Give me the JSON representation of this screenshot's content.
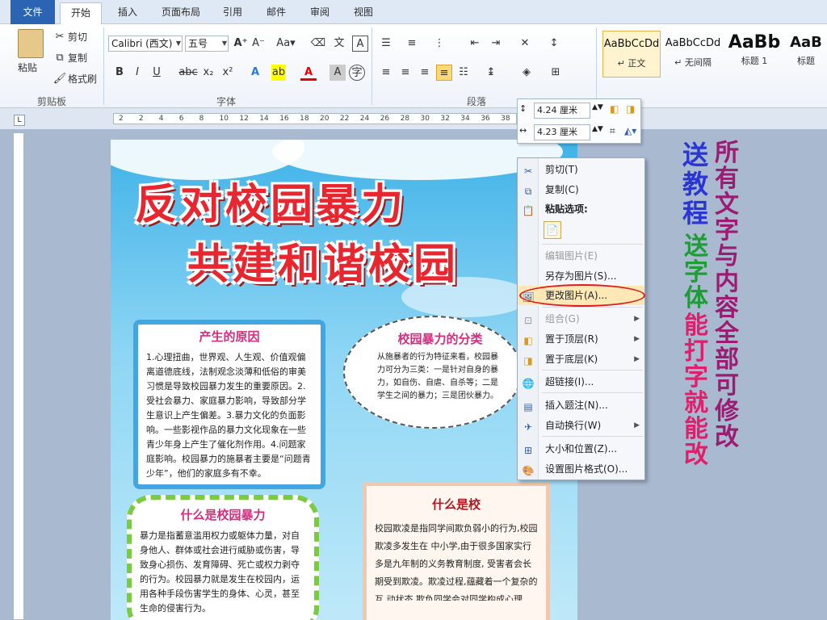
{
  "tabs": [
    "文件",
    "开始",
    "插入",
    "页面布局",
    "引用",
    "邮件",
    "审阅",
    "视图"
  ],
  "clipboard": {
    "paste": "粘贴",
    "cut": "剪切",
    "copy": "复制",
    "format_painter": "格式刷",
    "group_label": "剪贴板"
  },
  "font": {
    "name": "Calibri (西文)",
    "size": "五号",
    "group_label": "字体"
  },
  "paragraph": {
    "group_label": "段落"
  },
  "styles": [
    {
      "sample": "AaBbCcDd",
      "name": "↵ 正文"
    },
    {
      "sample": "AaBbCcDd",
      "name": "↵ 无间隔"
    },
    {
      "sample": "AaBb",
      "name": "标题 1"
    },
    {
      "sample": "AaB",
      "name": "标题"
    }
  ],
  "ruler": {
    "ticks": [
      "2",
      "2",
      "4",
      "6",
      "8",
      "10",
      "12",
      "14",
      "16",
      "18",
      "20",
      "22",
      "24",
      "26",
      "28",
      "30",
      "32",
      "34",
      "36",
      "38"
    ]
  },
  "size_toolbar": {
    "height": "4.24 厘米",
    "width": "4.23 厘米"
  },
  "poster": {
    "title_line1": "反对校园暴力",
    "title_line2": "共建和谐校园",
    "cause_title": "产生的原因",
    "cause_text": "1.心理扭曲，世界观、人生观、价值观偏离道德底线，法制观念淡薄和低俗的审美习惯是导致校园暴力发生的重要原因。2.受社会暴力、家庭暴力影响，导致部分学生意识上产生偏差。3.暴力文化的负面影响。一些影视作品的暴力文化现象在一些青少年身上产生了催化剂作用。4.问题家庭影响。校园暴力的施暴者主要是“问题青少年”，他们的家庭多有不幸。",
    "types_title": "校园暴力的分类",
    "types_text": "从施暴者的行为特征来看，校园暴力可分为三类：一是针对自身的暴力，如自伤、自虐、自杀等；二是学生之间的暴力；三是团伙暴力。",
    "what_title": "什么是校园暴力",
    "what_text": "暴力是指蓄意滥用权力或躯体力量，对自身他人、群体或社会进行威胁或伤害，导致身心损伤、发育障碍、死亡或权力剥夺的行为。校园暴力就是发生在校园内，运用各种手段伤害学生的身体、心灵，甚至生命的侵害行为。",
    "school_title": "什么是校",
    "school_text": "校园欺凌是指同学间欺负弱小的行为,校园欺凌多发生在 中小学,由于很多国家实行多是九年制的义务教育制度, 受害者会长期受到欺凌。欺凌过程,蕴藏着一个复杂的互 动状态 欺负同学会对同学构成心理"
  },
  "context_menu": [
    {
      "label": "剪切(T)",
      "icon": "scissors-icon",
      "state": "normal"
    },
    {
      "label": "复制(C)",
      "icon": "copy-icon",
      "state": "normal"
    },
    {
      "label": "粘贴选项:",
      "icon": "paste-icon",
      "state": "bold"
    },
    {
      "label": "",
      "icon": "paste-picture-icon",
      "state": "normal"
    },
    {
      "label": "编辑图片(E)",
      "icon": "",
      "state": "disabled"
    },
    {
      "label": "另存为图片(S)...",
      "icon": "",
      "state": "normal"
    },
    {
      "label": "更改图片(A)...",
      "icon": "change-picture-icon",
      "state": "highlighted"
    },
    {
      "label": "组合(G)",
      "icon": "group-icon",
      "state": "disabled"
    },
    {
      "label": "置于顶层(R)",
      "icon": "bring-front-icon",
      "state": "normal"
    },
    {
      "label": "置于底层(K)",
      "icon": "send-back-icon",
      "state": "normal"
    },
    {
      "label": "超链接(I)...",
      "icon": "hyperlink-icon",
      "state": "normal"
    },
    {
      "label": "插入题注(N)...",
      "icon": "caption-icon",
      "state": "normal"
    },
    {
      "label": "自动换行(W)",
      "icon": "wrap-icon",
      "state": "normal"
    },
    {
      "label": "大小和位置(Z)...",
      "icon": "size-position-icon",
      "state": "normal"
    },
    {
      "label": "设置图片格式(O)...",
      "icon": "format-picture-icon",
      "state": "normal"
    }
  ],
  "promo": {
    "line1": "所有文字与内容全部可修改",
    "line2": "送教程",
    "line3": "送字体",
    "line4": "能打字就能改"
  },
  "colors": {
    "accent": "#2a64b3",
    "highlight_oval": "#e21b1b",
    "title_red": "#e8262f"
  }
}
